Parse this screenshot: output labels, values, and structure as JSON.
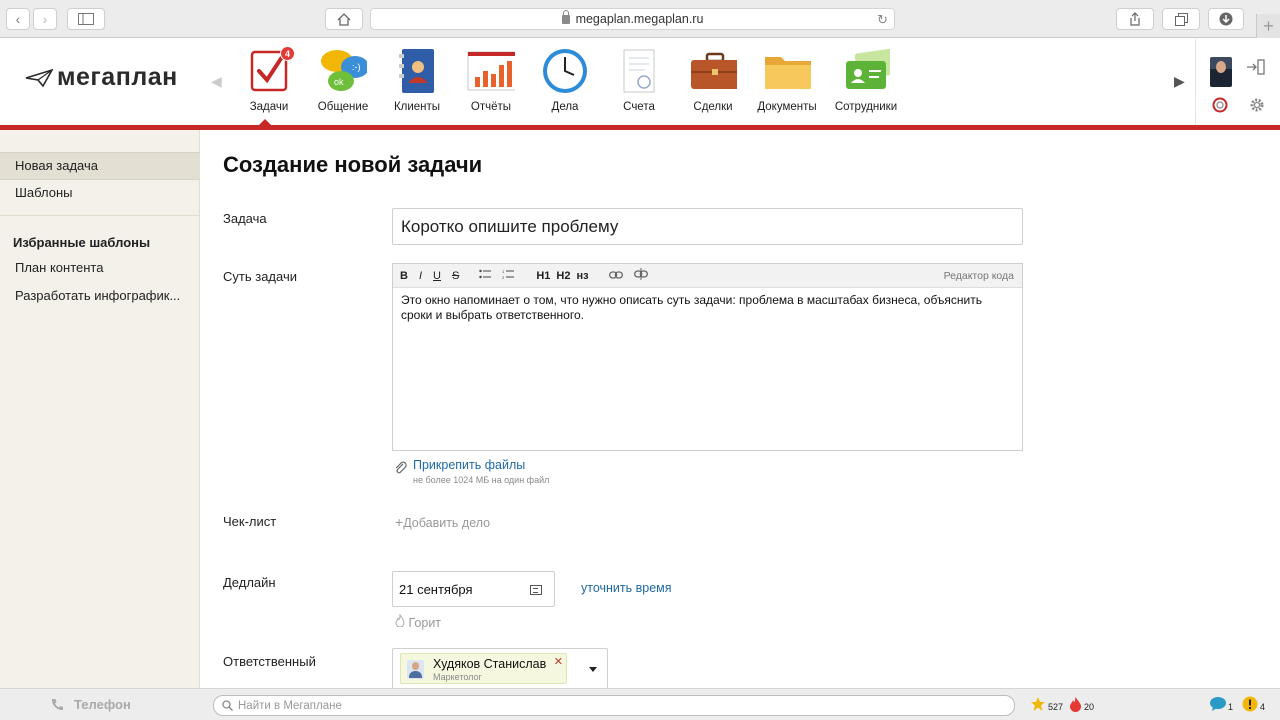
{
  "browser": {
    "url": "megaplan.megaplan.ru"
  },
  "app": {
    "logo_text": "мегаплан"
  },
  "nav": {
    "items": [
      {
        "label": "Задачи",
        "badge": "4"
      },
      {
        "label": "Общение"
      },
      {
        "label": "Клиенты"
      },
      {
        "label": "Отчёты"
      },
      {
        "label": "Дела"
      },
      {
        "label": "Счета"
      },
      {
        "label": "Сделки"
      },
      {
        "label": "Документы"
      },
      {
        "label": "Сотрудники"
      }
    ]
  },
  "sidebar": {
    "new_task": "Новая задача",
    "templates": "Шаблоны",
    "favorites_heading": "Избранные шаблоны",
    "favorites": [
      "План контента",
      "Разработать инфографик..."
    ]
  },
  "form": {
    "title": "Создание новой задачи",
    "task_label": "Задача",
    "task_placeholder": "Коротко опишите проблему",
    "essence_label": "Суть задачи",
    "toolbar": {
      "bold": "B",
      "italic": "I",
      "underline": "U",
      "strike": "S",
      "h1": "H1",
      "h2": "H2",
      "h3": "нз",
      "code_editor": "Редактор кода"
    },
    "essence_text": "Это окно напоминает о том, что нужно описать суть задачи: проблема в масштабах бизнеса, объяснить сроки и выбрать ответственного.",
    "attach_label": "Прикрепить файлы",
    "attach_hint": "не более 1024 МБ на один файл",
    "checklist_label": "Чек-лист",
    "add_item": "Добавить дело",
    "deadline_label": "Дедлайн",
    "deadline_value": "21 сентября",
    "refine_time": "уточнить время",
    "burning": "Горит",
    "responsible_label": "Ответственный",
    "responsible_name": "Худяков Станислав",
    "responsible_role": "Маркетолог"
  },
  "bottom": {
    "phone": "Телефон",
    "search_placeholder": "Найти в Мегаплане",
    "stars": "527",
    "fire": "20",
    "messages": "1",
    "warnings": "4"
  },
  "colors": {
    "accent_red": "#c62828",
    "link_blue": "#1f6aa5",
    "sidebar_bg": "#f4f1ea"
  }
}
